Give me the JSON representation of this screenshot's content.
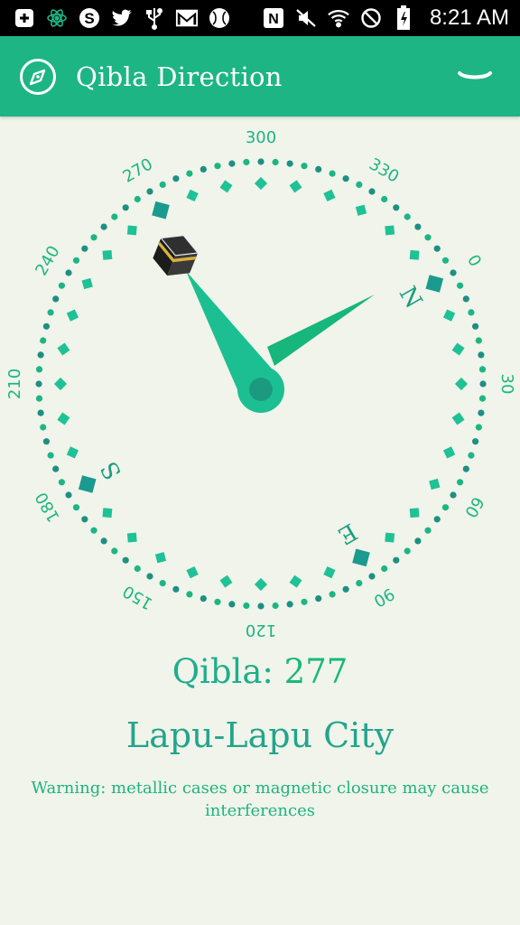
{
  "status_bar": {
    "time": "8:21 AM",
    "icons": [
      "add-icon",
      "atom-icon",
      "skype-icon",
      "twitter-icon",
      "usb-icon",
      "gmail-icon",
      "ball-icon",
      "nfc-icon",
      "mute-icon",
      "wifi-icon",
      "blocked-icon",
      "battery-icon"
    ]
  },
  "app_bar": {
    "title": "Qibla Direction",
    "icon": "compass-icon",
    "menu_icon": "chevron-down-icon",
    "color": "#1db584"
  },
  "compass": {
    "degree_labels": [
      "0",
      "30",
      "60",
      "90",
      "120",
      "150",
      "180",
      "210",
      "240",
      "270",
      "300",
      "330"
    ],
    "cardinal_labels": [
      "N",
      "E",
      "S"
    ],
    "qibla_heading": 277,
    "accent_color": "#1db584",
    "dot_color": "#1e8f83"
  },
  "qibla": {
    "label": "Qibla:",
    "value": "277"
  },
  "location": {
    "city": "Lapu-Lapu City"
  },
  "warning": {
    "text": "Warning: metallic cases or magnetic closure may cause interferences"
  }
}
